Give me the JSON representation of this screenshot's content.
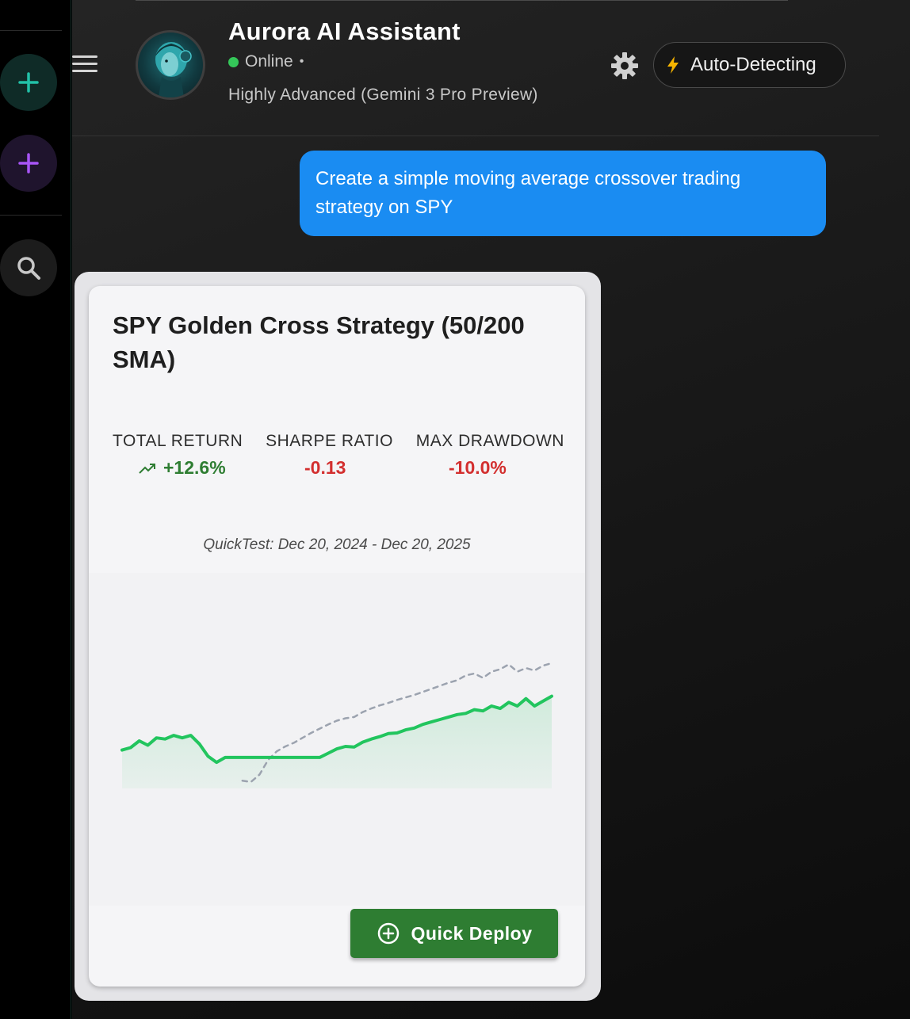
{
  "sidebar": {
    "buttons": [
      {
        "icon": "plus-icon",
        "color": "#22c1a8"
      },
      {
        "icon": "plus-icon",
        "color": "#a855f7"
      },
      {
        "icon": "search-icon",
        "color": "#c8c8c8"
      }
    ]
  },
  "header": {
    "assistant_name": "Aurora AI Assistant",
    "status": "Online",
    "status_separator": "•",
    "model": "Highly Advanced (Gemini 3 Pro Preview)",
    "mode_icon": "lightning-icon",
    "mode_label": "Auto-Detecting"
  },
  "chat": {
    "user_message": "Create a simple moving average crossover trading strategy on SPY"
  },
  "strategy_card": {
    "title": "SPY Golden Cross Strategy (50/200 SMA)",
    "metrics": [
      {
        "label": "TOTAL RETURN",
        "value": "+12.6%",
        "color": "#2e7d32"
      },
      {
        "label": "SHARPE RATIO",
        "value": "-0.13",
        "color": "#d32f2f"
      },
      {
        "label": "MAX DRAWDOWN",
        "value": "-10.0%",
        "color": "#d32f2f"
      }
    ],
    "quicktest": "QuickTest: Dec 20, 2024 - Dec 20, 2025",
    "deploy_label": "Quick Deploy"
  },
  "chart_data": {
    "type": "line",
    "x": [
      0,
      1,
      2,
      3,
      4,
      5,
      6,
      7,
      8,
      9,
      10,
      11,
      12,
      13,
      14,
      15,
      16,
      17,
      18,
      19,
      20,
      21,
      22,
      23,
      24,
      25,
      26,
      27,
      28,
      29,
      30,
      31,
      32,
      33,
      34,
      35,
      36,
      37,
      38,
      39,
      40,
      41,
      42,
      43,
      44,
      45,
      46,
      47,
      48,
      49,
      50
    ],
    "series": [
      {
        "style": "solid",
        "color": "#22c55e",
        "values": [
          0.2,
          0.24,
          0.35,
          0.28,
          0.4,
          0.38,
          0.44,
          0.4,
          0.44,
          0.3,
          0.1,
          0.0,
          0.08,
          0.08,
          0.08,
          0.08,
          0.08,
          0.08,
          0.08,
          0.08,
          0.08,
          0.08,
          0.08,
          0.08,
          0.15,
          0.22,
          0.26,
          0.25,
          0.33,
          0.38,
          0.42,
          0.47,
          0.48,
          0.53,
          0.56,
          0.62,
          0.66,
          0.7,
          0.74,
          0.78,
          0.8,
          0.86,
          0.84,
          0.92,
          0.88,
          0.98,
          0.92,
          1.04,
          0.92,
          1.0,
          1.08
        ]
      },
      {
        "style": "dashed",
        "color": "#9ca3af",
        "values": [
          null,
          null,
          null,
          null,
          null,
          null,
          null,
          null,
          null,
          null,
          null,
          null,
          null,
          null,
          -0.3,
          -0.32,
          -0.2,
          0.04,
          0.18,
          0.26,
          0.32,
          0.4,
          0.48,
          0.55,
          0.62,
          0.68,
          0.72,
          0.74,
          0.82,
          0.88,
          0.93,
          0.97,
          1.02,
          1.06,
          1.1,
          1.15,
          1.2,
          1.25,
          1.3,
          1.34,
          1.42,
          1.45,
          1.38,
          1.48,
          1.52,
          1.6,
          1.48,
          1.54,
          1.5,
          1.58,
          1.62
        ]
      }
    ],
    "ylim": [
      -0.4,
      1.8
    ]
  }
}
